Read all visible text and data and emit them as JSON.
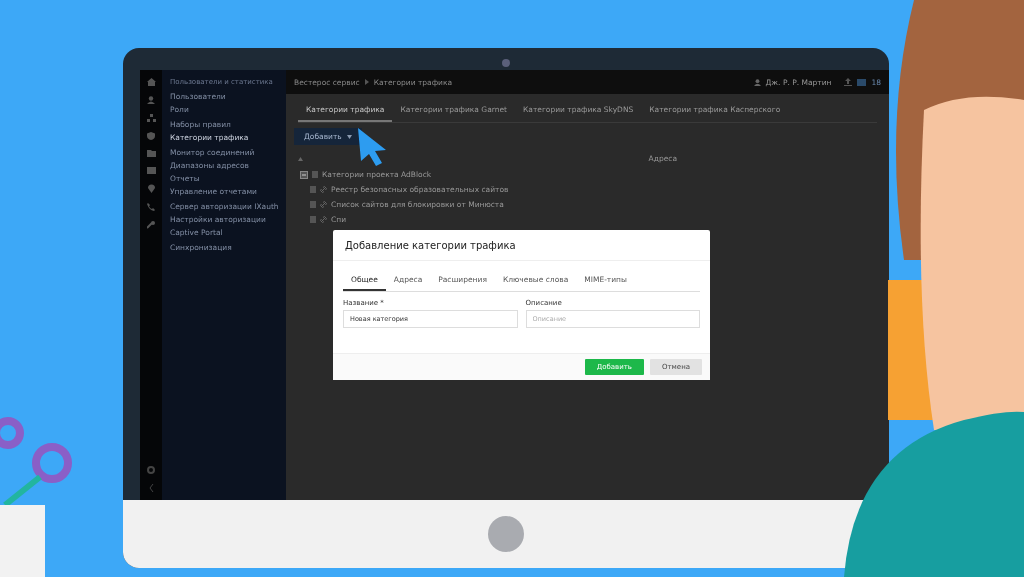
{
  "sidebar": {
    "heading": "Пользователи и статистика",
    "groups": [
      [
        {
          "label": "Пользователи",
          "selected": false
        },
        {
          "label": "Роли",
          "selected": false
        }
      ],
      [
        {
          "label": "Наборы правил",
          "selected": false
        },
        {
          "label": "Категории трафика",
          "selected": true
        }
      ],
      [
        {
          "label": "Монитор соединений",
          "selected": false
        },
        {
          "label": "Диапазоны адресов",
          "selected": false
        },
        {
          "label": "Отчеты",
          "selected": false
        },
        {
          "label": "Управление отчетами",
          "selected": false
        }
      ],
      [
        {
          "label": "Сервер авторизации IXauth",
          "selected": false
        },
        {
          "label": "Настройки авторизации",
          "selected": false
        },
        {
          "label": "Captive Portal",
          "selected": false
        }
      ],
      [
        {
          "label": "Синхронизация",
          "selected": false
        }
      ]
    ]
  },
  "header": {
    "breadcrumb": [
      "Вестерос сервис",
      "Категории трафика"
    ],
    "user": "Дж. Р. Р. Мартин",
    "time": "18"
  },
  "tabs": [
    {
      "label": "Категории трафика",
      "selected": true
    },
    {
      "label": "Категории трафика Garnet",
      "selected": false
    },
    {
      "label": "Категории трафика SkyDNS",
      "selected": false
    },
    {
      "label": "Категории трафика Касперского",
      "selected": false
    }
  ],
  "toolbar": {
    "add_button": "Добавить"
  },
  "table": {
    "columns": [
      "Адреса"
    ],
    "group": {
      "label": "Категории проекта AdBlock",
      "expanded": true
    },
    "rows": [
      {
        "name": "Реестр безопасных образовательных сайтов"
      },
      {
        "name": "Список сайтов для блокировки от Минюста"
      },
      {
        "name": "Спи"
      }
    ]
  },
  "dialog": {
    "title": "Добавление категории трафика",
    "tabs": [
      {
        "label": "Общее",
        "selected": true
      },
      {
        "label": "Адреса",
        "selected": false
      },
      {
        "label": "Расширения",
        "selected": false
      },
      {
        "label": "Ключевые слова",
        "selected": false
      },
      {
        "label": "MIME-типы",
        "selected": false
      }
    ],
    "fields": [
      {
        "label": "Название *",
        "value": "Новая категория"
      },
      {
        "label": "Описание",
        "placeholder": "Описание"
      }
    ],
    "buttons": [
      {
        "label": "Добавить",
        "kind": "primary"
      },
      {
        "label": "Отмена",
        "kind": "secondary"
      }
    ]
  }
}
